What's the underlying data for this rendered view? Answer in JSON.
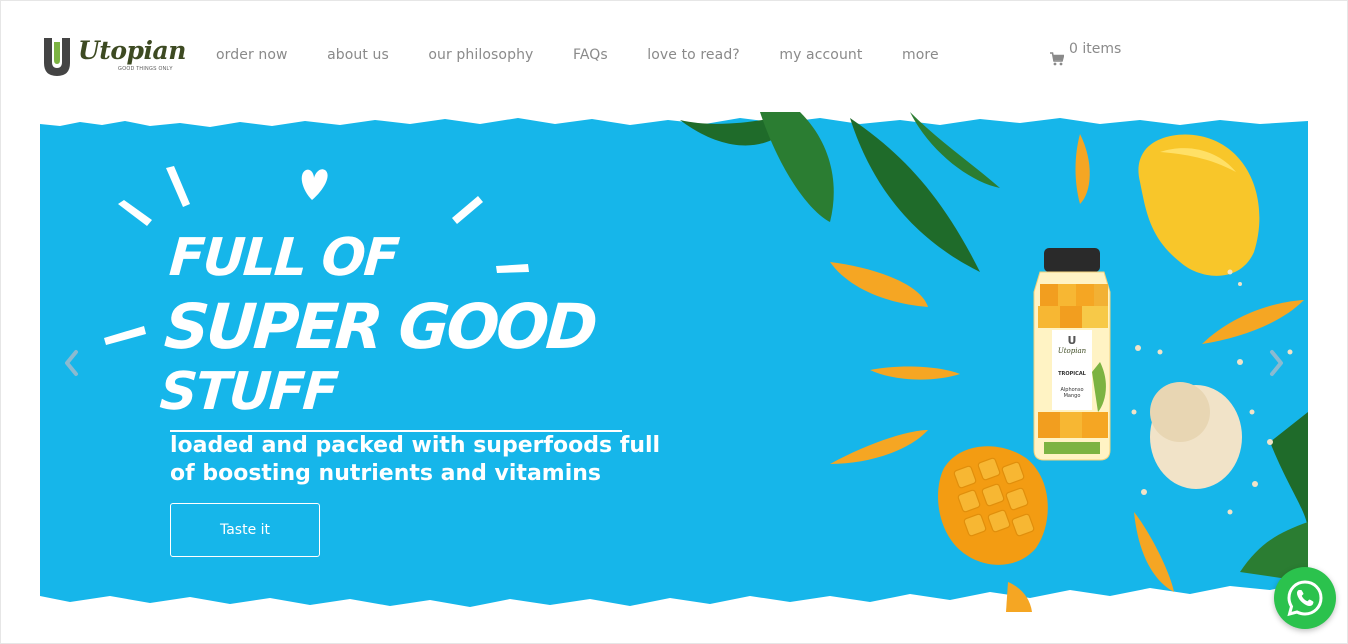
{
  "brand": {
    "name": "Utopian",
    "tagline": "GOOD THINGS ONLY",
    "logo_letter": "U",
    "colors": {
      "primary": "#3d4a22",
      "accent": "#7cb342"
    }
  },
  "nav": {
    "items": [
      {
        "label": "order now"
      },
      {
        "label": "about us"
      },
      {
        "label": "our philosophy"
      },
      {
        "label": "FAQs"
      },
      {
        "label": "love to read?"
      },
      {
        "label": "my account"
      },
      {
        "label": "more"
      }
    ]
  },
  "cart": {
    "icon": "cart-icon",
    "label": "0 items"
  },
  "hero": {
    "background_color": "#16b6ea",
    "headline_line1": "FULL OF",
    "headline_line2": "SUPER GOOD",
    "headline_line3": "STUFF",
    "subtitle": "loaded and packed with superfoods full of boosting nutrients and vitamins",
    "cta_label": "Taste it",
    "prev_icon": "chevron-left-icon",
    "next_icon": "chevron-right-icon",
    "product": {
      "brand": "Utopian",
      "name": "TROPICAL",
      "flavor": "Alphonso Mango"
    }
  },
  "whatsapp": {
    "icon": "whatsapp-icon",
    "color": "#2bc24d"
  }
}
